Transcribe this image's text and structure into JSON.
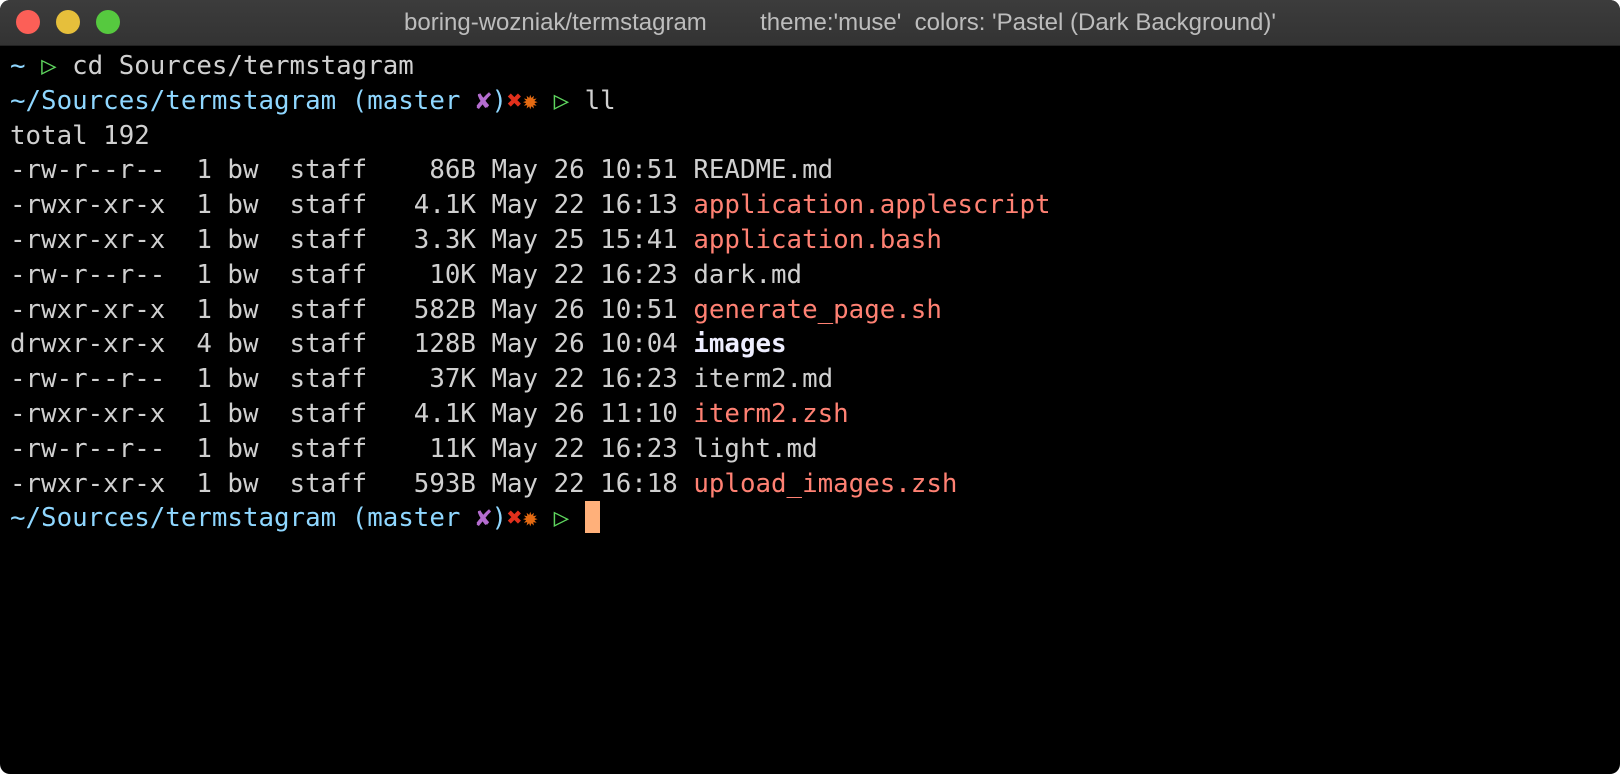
{
  "window": {
    "title": "boring-wozniak/termstagram        theme:'muse'  colors: 'Pastel (Dark Background)'"
  },
  "prompt": {
    "home": "~",
    "arrow": "▷",
    "path": "~/Sources/termstagram",
    "branch_open": "(master ",
    "dirty": "✘",
    "branch_close": ")",
    "error_mark": "✖",
    "stash_mark": "✹"
  },
  "commands": [
    "cd Sources/termstagram",
    "ll"
  ],
  "total": "total 192",
  "files": [
    {
      "meta": "-rw-r--r--  1 bw  staff    86B May 26 10:51 ",
      "name": "README.md",
      "type": "file"
    },
    {
      "meta": "-rwxr-xr-x  1 bw  staff   4.1K May 22 16:13 ",
      "name": "application.applescript",
      "type": "exec"
    },
    {
      "meta": "-rwxr-xr-x  1 bw  staff   3.3K May 25 15:41 ",
      "name": "application.bash",
      "type": "exec"
    },
    {
      "meta": "-rw-r--r--  1 bw  staff    10K May 22 16:23 ",
      "name": "dark.md",
      "type": "file"
    },
    {
      "meta": "-rwxr-xr-x  1 bw  staff   582B May 26 10:51 ",
      "name": "generate_page.sh",
      "type": "exec"
    },
    {
      "meta": "drwxr-xr-x  4 bw  staff   128B May 26 10:04 ",
      "name": "images",
      "type": "dir"
    },
    {
      "meta": "-rw-r--r--  1 bw  staff    37K May 22 16:23 ",
      "name": "iterm2.md",
      "type": "file"
    },
    {
      "meta": "-rwxr-xr-x  1 bw  staff   4.1K May 26 11:10 ",
      "name": "iterm2.zsh",
      "type": "exec"
    },
    {
      "meta": "-rw-r--r--  1 bw  staff    11K May 22 16:23 ",
      "name": "light.md",
      "type": "file"
    },
    {
      "meta": "-rwxr-xr-x  1 bw  staff   593B May 22 16:18 ",
      "name": "upload_images.zsh",
      "type": "exec"
    }
  ],
  "colors": {
    "path": "#8fd7ff",
    "arrow": "#5ed55e",
    "exec": "#ff8173",
    "cursor": "#ffb07a"
  }
}
